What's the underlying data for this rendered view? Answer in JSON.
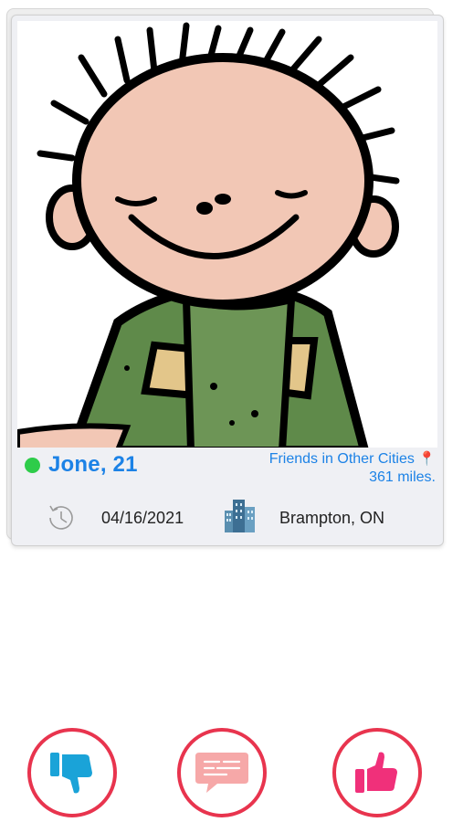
{
  "profile": {
    "name_age": "Jone, 21",
    "online": true,
    "distance_label": "Friends in Other Cities",
    "distance_value": "361 miles.",
    "last_active_date": "04/16/2021",
    "location": "Brampton, ON"
  },
  "icons": {
    "online": "online-dot",
    "clock": "history-clock-icon",
    "city": "city-buildings-icon",
    "pin": "location-pin-icon",
    "dislike": "thumbs-down-icon",
    "message": "chat-bubble-icon",
    "like": "thumbs-up-icon"
  },
  "colors": {
    "accent_blue": "#1c82e6",
    "online_green": "#2ecc4a",
    "button_ring": "#e8344e",
    "dislike_icon": "#1aa3d8",
    "message_icon": "#f6a8a8",
    "like_icon": "#f0307a"
  }
}
